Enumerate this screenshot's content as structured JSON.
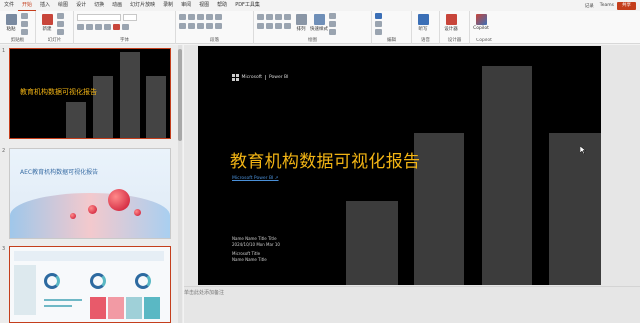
{
  "menu": {
    "tabs": [
      "文件",
      "开始",
      "插入",
      "绘图",
      "设计",
      "切换",
      "动画",
      "幻灯片放映",
      "录制",
      "审阅",
      "视图",
      "帮助",
      "PDF工具集"
    ],
    "active_tab": "开始",
    "right_items": [
      "记录",
      "Teams",
      "共享"
    ]
  },
  "ribbon": {
    "groups": [
      {
        "label": "剪贴板",
        "buttons": [
          "粘贴"
        ]
      },
      {
        "label": "幻灯片",
        "buttons": [
          "新建"
        ]
      },
      {
        "label": "字体",
        "buttons": []
      },
      {
        "label": "段落",
        "buttons": []
      },
      {
        "label": "绘图",
        "buttons": [
          "形状",
          "排列",
          "快速样式"
        ]
      },
      {
        "label": "编辑",
        "buttons": []
      },
      {
        "label": "语音",
        "buttons": [
          "听写"
        ]
      },
      {
        "label": "设计器",
        "buttons": [
          "设计器"
        ]
      },
      {
        "label": "Copilot",
        "buttons": [
          "Copilot"
        ]
      }
    ]
  },
  "thumbnails": [
    {
      "number": "1",
      "title": "教育机构数据可视化报告"
    },
    {
      "number": "2",
      "title": "AEC教育机构数据可视化报告"
    },
    {
      "number": "3",
      "title": ""
    }
  ],
  "slide": {
    "brand_name": "Microsoft",
    "brand_product": "Power BI",
    "title": "教育机构数据可视化报告",
    "subtitle": "Microsoft Power BI  ↗",
    "meta_line1": "Name Name  Title Title",
    "meta_line2": "2024/10/10  Mon Mar 10",
    "meta_line3": "Microsoft Title",
    "meta_line4": "Name Name  Title",
    "title_color": "#f2b414"
  },
  "notes": {
    "placeholder": "单击此处添加备注"
  }
}
